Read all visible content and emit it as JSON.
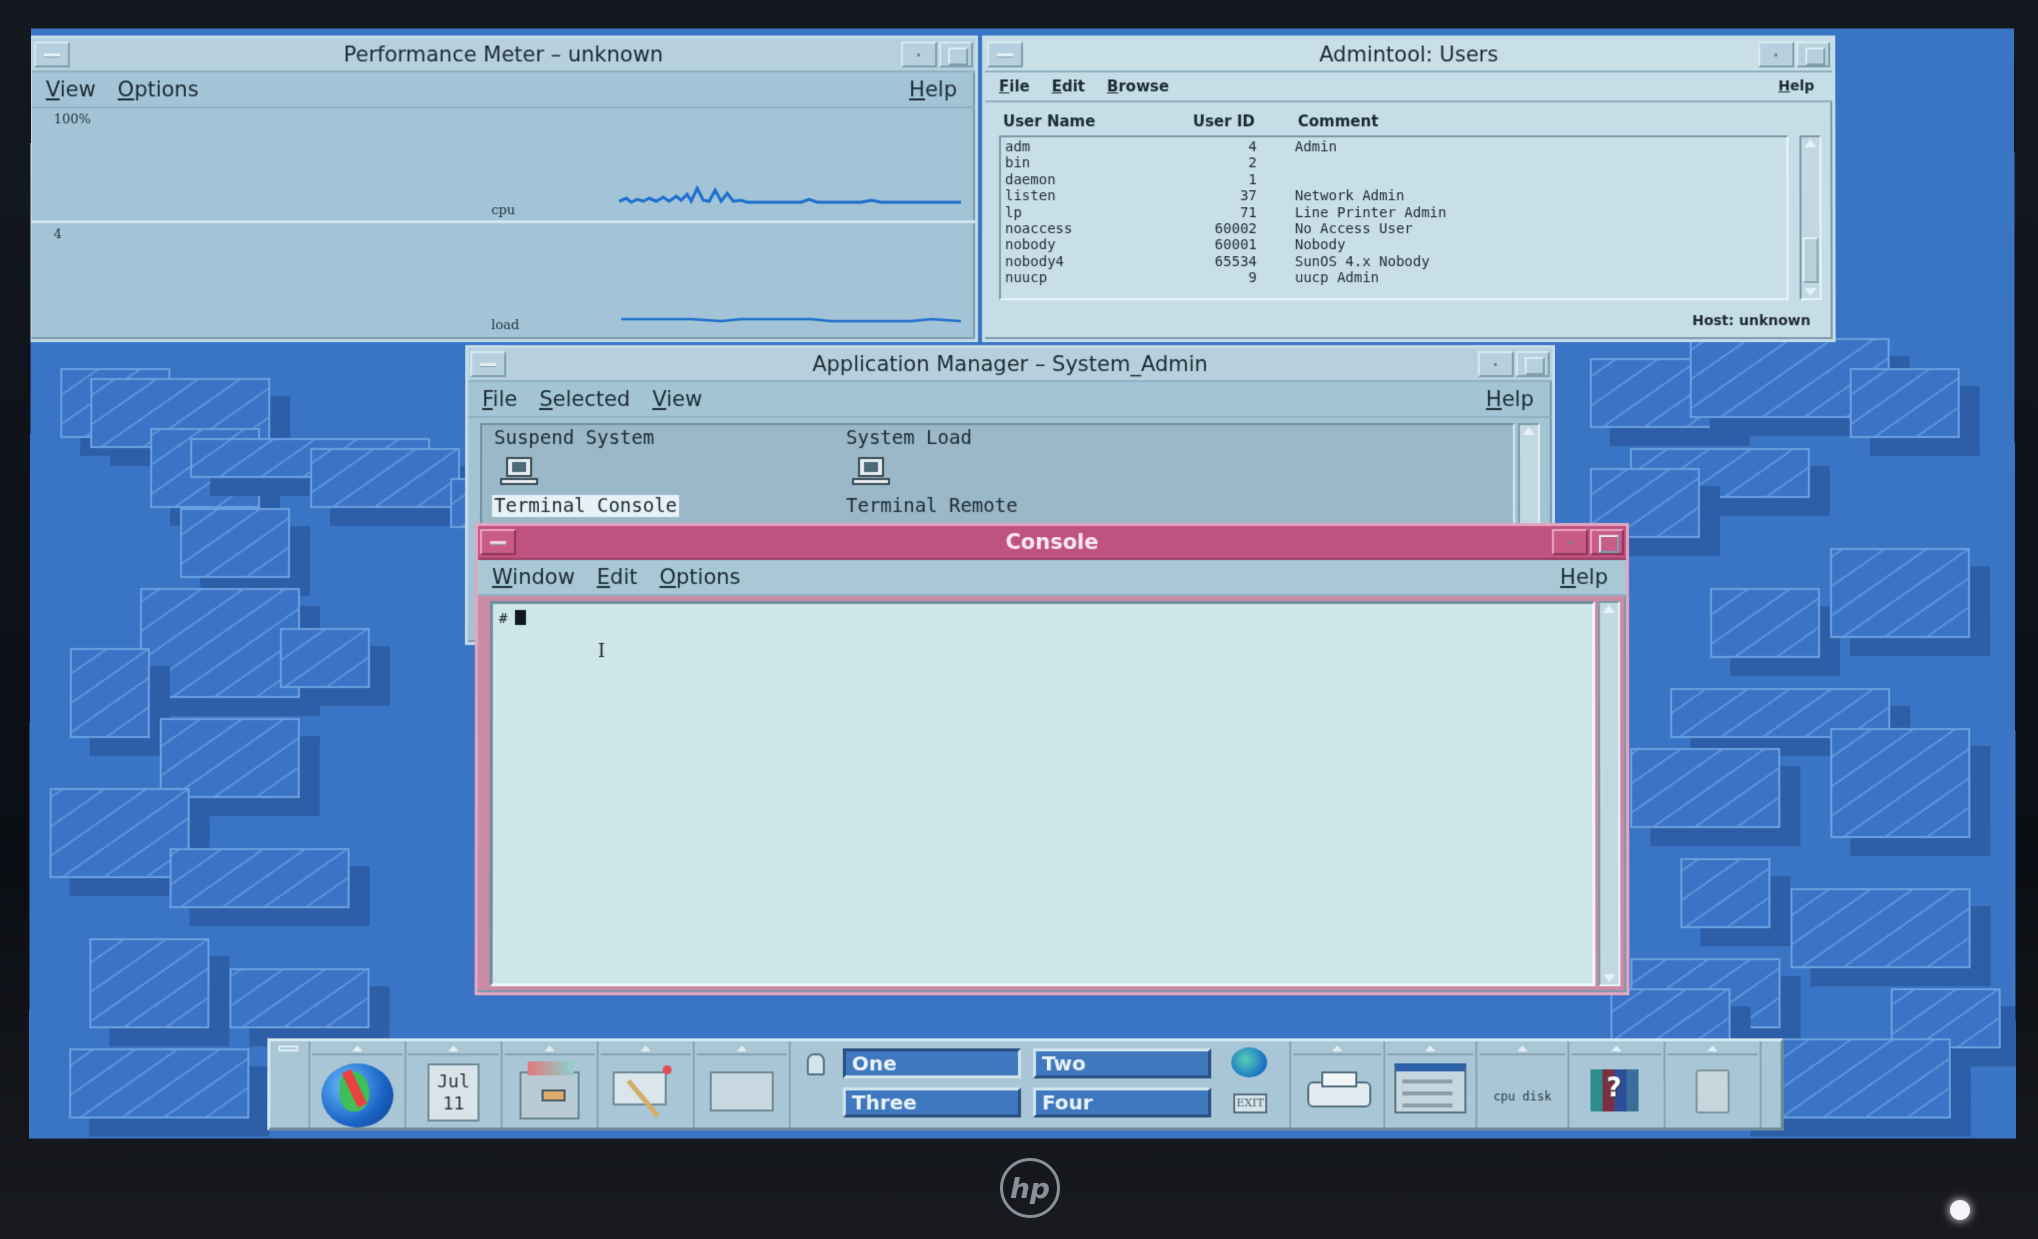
{
  "monitor": {
    "brand_logo": "hp",
    "power_icon": "power-led-icon"
  },
  "windows": {
    "performance_meter": {
      "title": "Performance Meter – unknown",
      "menu": [
        "View",
        "Options"
      ],
      "help": "Help",
      "graphs": [
        {
          "label": "cpu",
          "axis_max_label": "100%"
        },
        {
          "label": "load",
          "axis_max_label": "4"
        }
      ]
    },
    "admintool": {
      "title": "Admintool: Users",
      "menu": [
        "File",
        "Edit",
        "Browse"
      ],
      "help": "Help",
      "columns": [
        "User Name",
        "User ID",
        "Comment"
      ],
      "rows": [
        {
          "name": "adm",
          "id": "4",
          "comment": "Admin"
        },
        {
          "name": "bin",
          "id": "2",
          "comment": ""
        },
        {
          "name": "daemon",
          "id": "1",
          "comment": ""
        },
        {
          "name": "listen",
          "id": "37",
          "comment": "Network Admin"
        },
        {
          "name": "lp",
          "id": "71",
          "comment": "Line Printer Admin"
        },
        {
          "name": "noaccess",
          "id": "60002",
          "comment": "No Access User"
        },
        {
          "name": "nobody",
          "id": "60001",
          "comment": "Nobody"
        },
        {
          "name": "nobody4",
          "id": "65534",
          "comment": "SunOS 4.x Nobody"
        },
        {
          "name": "nuucp",
          "id": "9",
          "comment": "uucp Admin"
        }
      ],
      "host": "Host: unknown"
    },
    "app_manager": {
      "title": "Application Manager – System_Admin",
      "menu": [
        "File",
        "Selected",
        "View"
      ],
      "help": "Help",
      "items": [
        {
          "label": "Suspend System"
        },
        {
          "label": "System Load"
        },
        {
          "label": "Terminal Console",
          "selected": true
        },
        {
          "label": "Terminal Remote"
        }
      ]
    },
    "console": {
      "title": "Console",
      "menu": [
        "Window",
        "Edit",
        "Options"
      ],
      "help": "Help",
      "prompt": "#",
      "input": ""
    }
  },
  "front_panel": {
    "calendar": {
      "month": "Jul",
      "day": "11"
    },
    "workspaces": [
      {
        "label": "One",
        "active": true
      },
      {
        "label": "Two",
        "active": false
      },
      {
        "label": "Three",
        "active": false
      },
      {
        "label": "Four",
        "active": false
      }
    ],
    "exit_label": "EXIT",
    "monitor_label": "cpu disk"
  },
  "colors": {
    "desktop": "#3a74c4",
    "window_bg": "#a9c8d8",
    "active_title": "#c0527f",
    "workspace_button": "#3f78bf",
    "graph_line": "#1f6fd0"
  }
}
